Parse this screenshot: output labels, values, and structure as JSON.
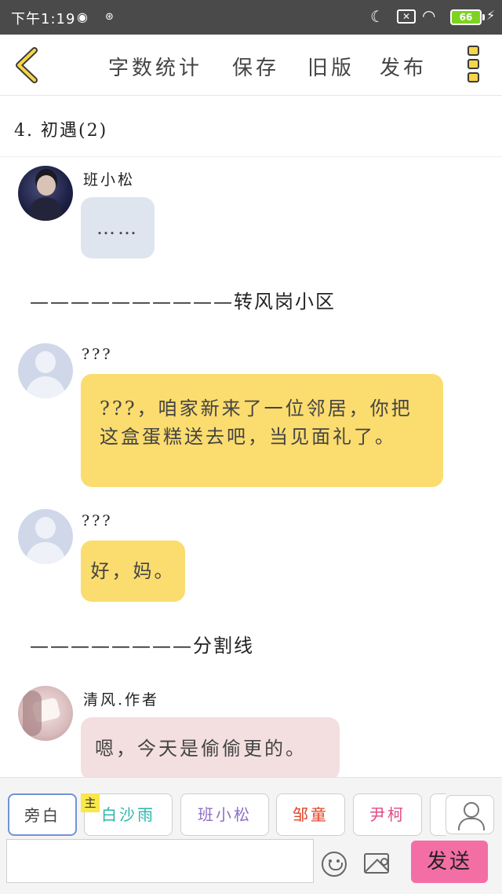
{
  "status_bar": {
    "time": "下午1:19",
    "battery": "66"
  },
  "toolbar": {
    "word_count": "字数统计",
    "save": "保存",
    "old_version": "旧版",
    "publish": "发布"
  },
  "chapter_title": "4. 初遇(2)",
  "messages": [
    {
      "name": "班小松",
      "text": "……"
    },
    {
      "name": "???",
      "text": "???，咱家新来了一位邻居，你把这盒蛋糕送去吧，当见面礼了。"
    },
    {
      "name": "???",
      "text": "好，妈。"
    },
    {
      "name": "清风.作者",
      "text": "嗯，今天是偷偷更的。"
    }
  ],
  "dividers": [
    "——————————转风岗小区",
    "————————分割线"
  ],
  "roles": {
    "main_tag": "主",
    "items": [
      "旁白",
      "白沙雨",
      "班小松",
      "邹童",
      "尹柯"
    ]
  },
  "composer": {
    "input_value": "",
    "send_label": "发送"
  },
  "colors": {
    "yellow_bubble": "#fbdc6e",
    "gray_bubble": "#dfe5ef",
    "pink_bubble": "#f3dfe0",
    "send_button": "#f46ea6",
    "status_bar": "#4a4a4a"
  }
}
